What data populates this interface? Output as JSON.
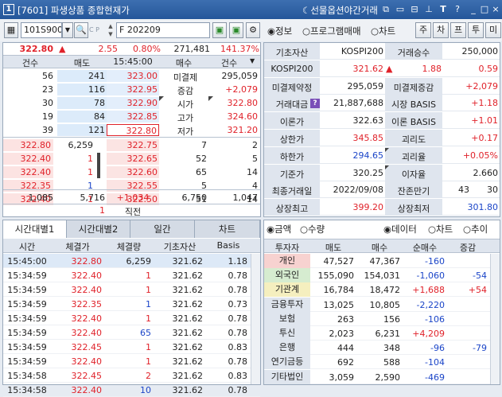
{
  "window": {
    "code": "[7601]",
    "title": "파생상품 종합현재가",
    "label": "선물옵션야간거래",
    "num_badge": "1"
  },
  "toolbar": {
    "code": "101S9000",
    "tiny_label": "C P",
    "product": "F 202209",
    "radios": [
      {
        "label": "정보",
        "selected": true
      },
      {
        "label": "프로그램매매",
        "selected": false
      },
      {
        "label": "차트",
        "selected": false
      }
    ],
    "buttons": [
      "주",
      "차",
      "프",
      "투",
      "미"
    ]
  },
  "price_row": {
    "price": "322.80",
    "arrow": "▲",
    "change": "2.55",
    "rate": "0.80%",
    "volume": "271,481",
    "ratio": "141.37%"
  },
  "orderbook": {
    "headers": [
      "건수",
      "매도",
      "15:45:00",
      "매수",
      "건수"
    ],
    "asks": [
      {
        "count": "56",
        "qty": "241",
        "price": "323.00",
        "label": "미결제",
        "value": "295,059",
        "vcolor": "black"
      },
      {
        "count": "23",
        "qty": "116",
        "price": "322.95",
        "label": "증감",
        "value": "+2,079",
        "vcolor": "red"
      },
      {
        "count": "30",
        "qty": "78",
        "price": "322.90",
        "label": "시가",
        "value": "322.80",
        "vcolor": "red"
      },
      {
        "count": "19",
        "qty": "84",
        "price": "322.85",
        "label": "고가",
        "value": "324.60",
        "vcolor": "red"
      },
      {
        "count": "39",
        "qty": "121",
        "price": "322.80",
        "label": "저가",
        "value": "321.20",
        "vcolor": "red"
      }
    ],
    "ticks": [
      {
        "price": "322.80",
        "qty": "6,259",
        "qcolor": "black"
      },
      {
        "price": "322.40",
        "qty": "1",
        "qcolor": "red"
      },
      {
        "price": "322.40",
        "qty": "1",
        "qcolor": "red"
      },
      {
        "price": "322.35",
        "qty": "1",
        "qcolor": "blue"
      },
      {
        "price": "322.40",
        "qty": "1",
        "qcolor": "red"
      }
    ],
    "bids": [
      {
        "price": "322.75",
        "qty": "7",
        "count": "2"
      },
      {
        "price": "322.65",
        "qty": "52",
        "count": "5"
      },
      {
        "price": "322.60",
        "qty": "65",
        "count": "14"
      },
      {
        "price": "322.55",
        "qty": "5",
        "count": "4"
      },
      {
        "price": "322.50",
        "qty": "51",
        "count": "14"
      }
    ],
    "totals": {
      "ask_count": "1,085",
      "ask_qty": "5,716",
      "diff": "+1,034",
      "bid_qty": "6,750",
      "bid_count": "1,047"
    },
    "bottom": {
      "value": "1",
      "label": "직전"
    }
  },
  "info": {
    "rows": [
      {
        "l1": "기초자산",
        "v1": "KOSPI200",
        "c1": "black",
        "l2": "거래승수",
        "v2": "250,000",
        "c2": "black"
      },
      {
        "l1": "KOSPI200",
        "v1": "321.62",
        "c1": "red",
        "arrow": "▲",
        "acolor": "red",
        "extra": "1.88",
        "c3": "red",
        "v2": "0.59",
        "c2": "red"
      },
      {
        "l1": "미결제약정",
        "v1": "295,059",
        "c1": "black",
        "l2": "미결제증감",
        "v2": "+2,079",
        "c2": "red"
      },
      {
        "l1": "거래대금",
        "v1": "21,887,688",
        "c1": "black",
        "l2": "시장 BASIS",
        "v2": "+1.18",
        "c2": "red"
      },
      {
        "l1": "이론가",
        "v1": "322.63",
        "c1": "black",
        "l2": "이론 BASIS",
        "v2": "+1.01",
        "c2": "red"
      },
      {
        "l1": "상한가",
        "v1": "345.85",
        "c1": "red",
        "l2": "괴리도",
        "v2": "+0.17",
        "c2": "red"
      },
      {
        "l1": "하한가",
        "v1": "294.65",
        "c1": "blue",
        "l2": "괴리율",
        "v2": "+0.05%",
        "c2": "red"
      },
      {
        "l1": "기준가",
        "v1": "320.25",
        "c1": "black",
        "l2": "이자율",
        "v2": "2.660",
        "c2": "black"
      },
      {
        "l1": "최종거래일",
        "v1": "2022/09/08",
        "c1": "black",
        "l2": "잔존만기",
        "v2a": "43",
        "v2": "30",
        "c2": "black"
      },
      {
        "l1": "상장최고",
        "v1": "399.20",
        "c1": "red",
        "l2": "상장최저",
        "v2": "301.80",
        "c2": "blue"
      }
    ],
    "help_icon": "?"
  },
  "tabs": [
    "시간대별1",
    "시간대별2",
    "일간",
    "차트"
  ],
  "time_table": {
    "headers": [
      "시간",
      "체결가",
      "체결량",
      "기초자산",
      "Basis"
    ],
    "rows": [
      {
        "time": "15:45:00",
        "price": "322.80",
        "qty": "6,259",
        "qc": "black",
        "base": "321.62",
        "basis": "1.18"
      },
      {
        "time": "15:34:59",
        "price": "322.40",
        "qty": "1",
        "qc": "red",
        "base": "321.62",
        "basis": "0.78"
      },
      {
        "time": "15:34:59",
        "price": "322.40",
        "qty": "1",
        "qc": "red",
        "base": "321.62",
        "basis": "0.78"
      },
      {
        "time": "15:34:59",
        "price": "322.35",
        "qty": "1",
        "qc": "blue",
        "base": "321.62",
        "basis": "0.73"
      },
      {
        "time": "15:34:59",
        "price": "322.40",
        "qty": "1",
        "qc": "red",
        "base": "321.62",
        "basis": "0.78"
      },
      {
        "time": "15:34:59",
        "price": "322.40",
        "qty": "65",
        "qc": "blue",
        "base": "321.62",
        "basis": "0.78"
      },
      {
        "time": "15:34:59",
        "price": "322.45",
        "qty": "1",
        "qc": "red",
        "base": "321.62",
        "basis": "0.83"
      },
      {
        "time": "15:34:59",
        "price": "322.40",
        "qty": "1",
        "qc": "red",
        "base": "321.62",
        "basis": "0.78"
      },
      {
        "time": "15:34:58",
        "price": "322.45",
        "qty": "2",
        "qc": "red",
        "base": "321.62",
        "basis": "0.83"
      },
      {
        "time": "15:34:58",
        "price": "322.40",
        "qty": "10",
        "qc": "blue",
        "base": "321.62",
        "basis": "0.78"
      }
    ]
  },
  "investor": {
    "radios_left": [
      {
        "label": "금액",
        "selected": true
      },
      {
        "label": "수량",
        "selected": false
      }
    ],
    "radios_right": [
      {
        "label": "데이터",
        "selected": true
      },
      {
        "label": "차트",
        "selected": false
      },
      {
        "label": "추이",
        "selected": false
      }
    ],
    "headers": [
      "투자자",
      "매도",
      "매수",
      "순매수",
      "증감"
    ],
    "rows": [
      {
        "name": "개인",
        "sell": "47,527",
        "buy": "47,367",
        "net": "-160",
        "nc": "blue",
        "chg": "",
        "cc": "black",
        "bg": "#f7d2d0"
      },
      {
        "name": "외국인",
        "sell": "155,090",
        "buy": "154,031",
        "net": "-1,060",
        "nc": "blue",
        "chg": "-54",
        "cc": "blue",
        "bg": "#d6ecd0"
      },
      {
        "name": "기관계",
        "sell": "16,784",
        "buy": "18,472",
        "net": "+1,688",
        "nc": "red",
        "chg": "+54",
        "cc": "red",
        "bg": "#f5efbf"
      },
      {
        "name": "금융투자",
        "sell": "13,025",
        "buy": "10,805",
        "net": "-2,220",
        "nc": "blue",
        "chg": "",
        "cc": "black",
        "bg": ""
      },
      {
        "name": "보험",
        "sell": "263",
        "buy": "156",
        "net": "-106",
        "nc": "blue",
        "chg": "",
        "cc": "black",
        "bg": ""
      },
      {
        "name": "투신",
        "sell": "2,023",
        "buy": "6,231",
        "net": "+4,209",
        "nc": "red",
        "chg": "",
        "cc": "black",
        "bg": ""
      },
      {
        "name": "은행",
        "sell": "444",
        "buy": "348",
        "net": "-96",
        "nc": "blue",
        "chg": "-79",
        "cc": "blue",
        "bg": ""
      },
      {
        "name": "연기금등",
        "sell": "692",
        "buy": "588",
        "net": "-104",
        "nc": "blue",
        "chg": "",
        "cc": "black",
        "bg": ""
      },
      {
        "name": "기타법인",
        "sell": "3,059",
        "buy": "2,590",
        "net": "-469",
        "nc": "blue",
        "chg": "",
        "cc": "black",
        "bg": ""
      }
    ]
  },
  "colors": {
    "red": "#e0222a",
    "blue": "#1b45c8",
    "ask_bar": "#9fc4ec",
    "bid_bar": "#f4b6b4",
    "header": "#dfe5ee"
  }
}
